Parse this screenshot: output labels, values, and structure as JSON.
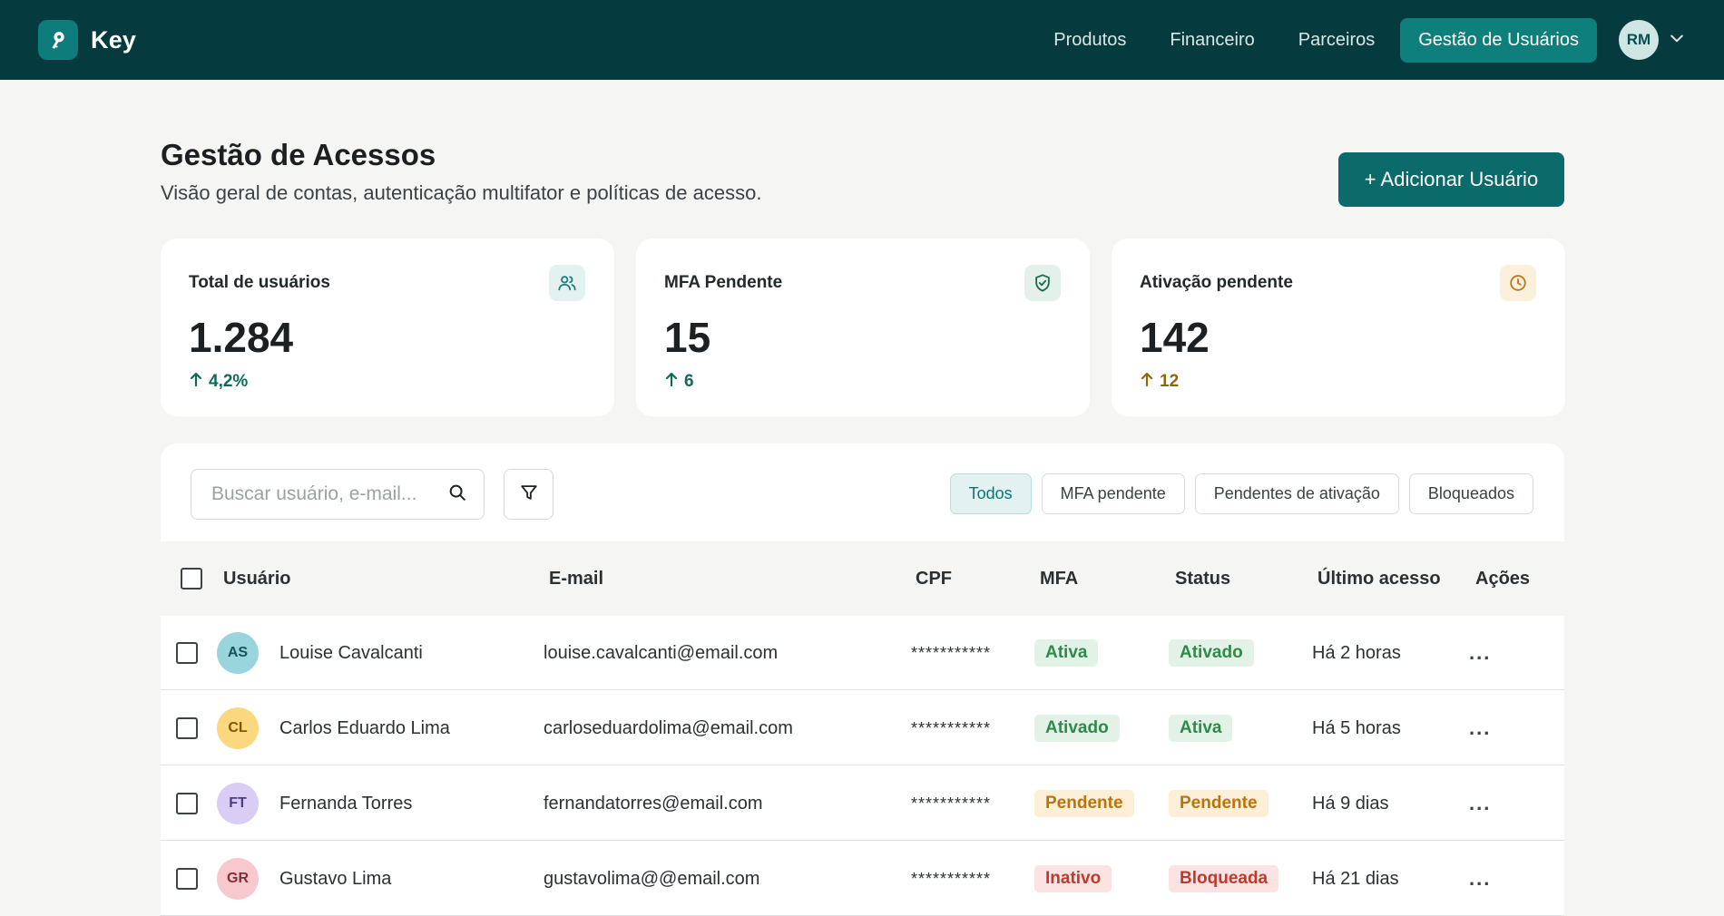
{
  "app": {
    "name": "Key"
  },
  "nav": {
    "items": [
      {
        "label": "Produtos"
      },
      {
        "label": "Financeiro"
      },
      {
        "label": "Parceiros"
      },
      {
        "label": "Gestão de Usuários",
        "active": true
      }
    ],
    "user_initials": "RM"
  },
  "header": {
    "title": "Gestão de Acessos",
    "subtitle": "Visão geral de contas, autenticação multifator e políticas de acesso.",
    "add_button": "+ Adicionar Usuário"
  },
  "stats": [
    {
      "label": "Total de usuários",
      "value": "1.284",
      "delta": "4,2%",
      "icon": "users-icon",
      "color": "#0f6b58",
      "icon_bg": "#e3f2f1",
      "icon_color": "#1a7f7d"
    },
    {
      "label": "MFA Pendente",
      "value": "15",
      "delta": "6",
      "icon": "shield-check-icon",
      "color": "#0f6b58",
      "icon_bg": "#e4f1ea",
      "icon_color": "#1e6b50"
    },
    {
      "label": "Ativação pendente",
      "value": "142",
      "delta": "12",
      "icon": "clock-icon",
      "color": "#8a6a08",
      "icon_bg": "#fbf0dc",
      "icon_color": "#b7791f"
    }
  ],
  "toolbar": {
    "search_placeholder": "Buscar usuário, e-mail...",
    "filters": [
      {
        "label": "Todos",
        "active": true
      },
      {
        "label": "MFA pendente"
      },
      {
        "label": "Pendentes de ativação"
      },
      {
        "label": "Bloqueados"
      }
    ]
  },
  "table": {
    "columns": {
      "user": "Usuário",
      "email": "E-mail",
      "cpf": "CPF",
      "mfa": "MFA",
      "status": "Status",
      "last_access": "Último acesso",
      "actions": "Ações"
    },
    "rows": [
      {
        "initials": "AS",
        "avatar_bg": "#9ad4dd",
        "avatar_color": "#15545b",
        "name": "Louise Cavalcanti",
        "email": "louise.cavalcanti@email.com",
        "cpf": "***********",
        "mfa": "Ativa",
        "mfa_bg": "#e2f2e6",
        "mfa_color": "#2f8a49",
        "status": "Ativado",
        "status_bg": "#e2f2e6",
        "status_color": "#2f8a49",
        "last_access": "Há 2 horas"
      },
      {
        "initials": "CL",
        "avatar_bg": "#fbd77f",
        "avatar_color": "#7a5a05",
        "name": "Carlos Eduardo Lima",
        "email": "carloseduardolima@email.com",
        "cpf": "***********",
        "mfa": "Ativado",
        "mfa_bg": "#e2f2e6",
        "mfa_color": "#2f8a49",
        "status": "Ativa",
        "status_bg": "#e2f2e6",
        "status_color": "#2f8a49",
        "last_access": "Há 5 horas"
      },
      {
        "initials": "FT",
        "avatar_bg": "#d9cdf5",
        "avatar_color": "#4e3a8a",
        "name": "Fernanda Torres",
        "email": "fernandatorres@email.com",
        "cpf": "***********",
        "mfa": "Pendente",
        "mfa_bg": "#fcefd8",
        "mfa_color": "#b9740f",
        "status": "Pendente",
        "status_bg": "#fcefd8",
        "status_color": "#b9740f",
        "last_access": "Há 9 dias"
      },
      {
        "initials": "GR",
        "avatar_bg": "#f7c9cf",
        "avatar_color": "#8a2a36",
        "name": "Gustavo Lima",
        "email": "gustavolima@@email.com",
        "cpf": "***********",
        "mfa": "Inativo",
        "mfa_bg": "#fbe3e3",
        "mfa_color": "#c0392b",
        "status": "Bloqueada",
        "status_bg": "#fbe3e3",
        "status_color": "#c0392b",
        "last_access": "Há 21 dias"
      }
    ],
    "actions_label": "..."
  }
}
